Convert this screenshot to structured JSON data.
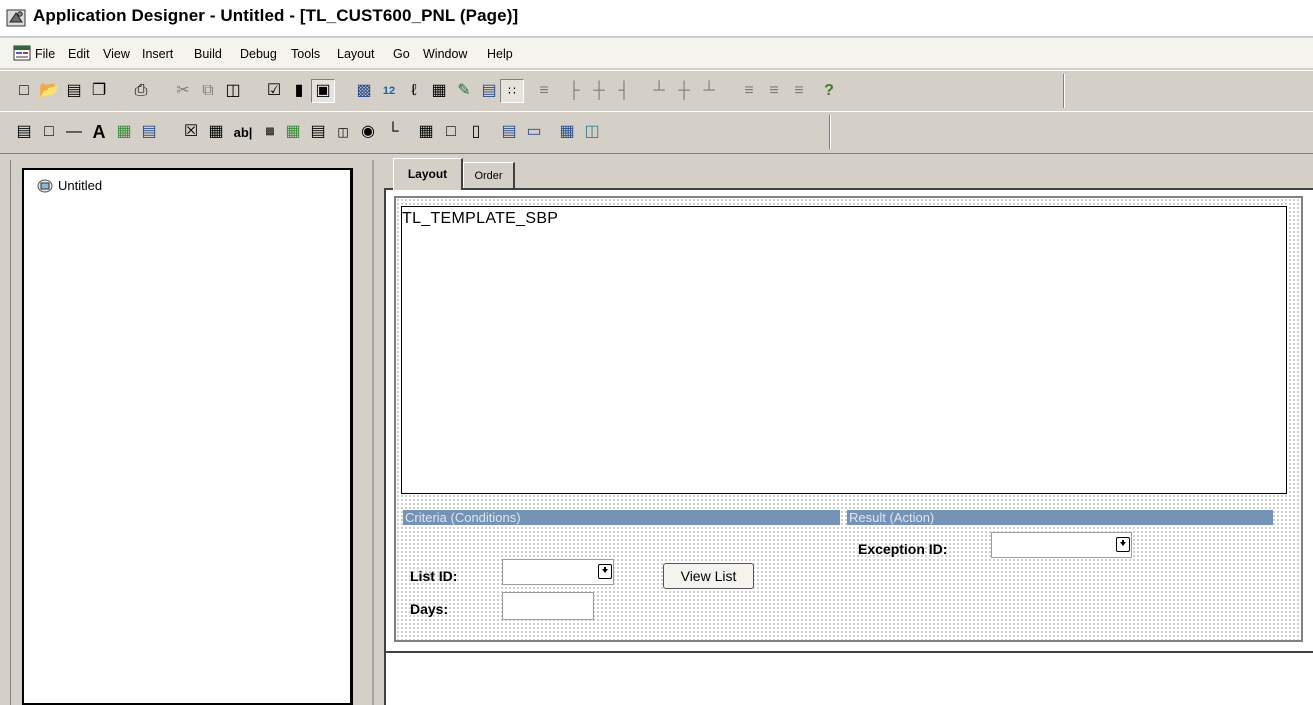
{
  "window": {
    "title": "Application Designer - Untitled - [TL_CUST600_PNL (Page)]"
  },
  "menu": {
    "items": [
      "File",
      "Edit",
      "View",
      "Insert",
      "Build",
      "Debug",
      "Tools",
      "Layout",
      "Go",
      "Window",
      "Help"
    ]
  },
  "toolbar2_text": {
    "static_text": "A",
    "edit_box": "ab|"
  },
  "project": {
    "root_label": "Untitled"
  },
  "tabs": {
    "layout": "Layout",
    "order": "Order"
  },
  "page": {
    "subpage_label": "TL_TEMPLATE_SBP",
    "criteria_header": "Criteria (Conditions)",
    "result_header": "Result (Action)",
    "list_id_label": "List ID:",
    "days_label": "Days:",
    "exception_id_label": "Exception ID:",
    "view_list_button": "View List"
  },
  "icons": {
    "toolbar1": [
      "new-icon",
      "open-icon",
      "save-icon",
      "save-all-icon",
      "print-icon",
      "cut-icon",
      "copy-icon",
      "paste-icon",
      "properties-icon",
      "project-icon",
      "page-icon",
      "insert-definition-icon",
      "tab-order-icon",
      "page-field-icon",
      "html-icon",
      "edit-icon",
      "grid-icon",
      "show-grid-icon",
      "align-left-icon",
      "align-center-icon",
      "align-right-icon",
      "align-top-icon",
      "align-middle-icon",
      "align-bottom-icon",
      "distribute-left-icon",
      "distribute-center-icon",
      "distribute-right-icon",
      "help-icon"
    ],
    "toolbar2": [
      "frame-icon",
      "group-box-icon",
      "horizontal-rule-icon",
      "static-text-icon",
      "static-image-icon",
      "chart-icon",
      "check-box-icon",
      "drop-down-list-icon",
      "edit-box-icon",
      "html-area-icon",
      "image-icon",
      "long-edit-box-icon",
      "push-button-icon",
      "radio-button-icon",
      "tree-icon",
      "grid-control-icon",
      "scroll-area-icon",
      "scroll-bar-icon",
      "secondary-page-icon",
      "subpage-icon",
      "analytic-grid-icon",
      "tab-icon"
    ]
  }
}
